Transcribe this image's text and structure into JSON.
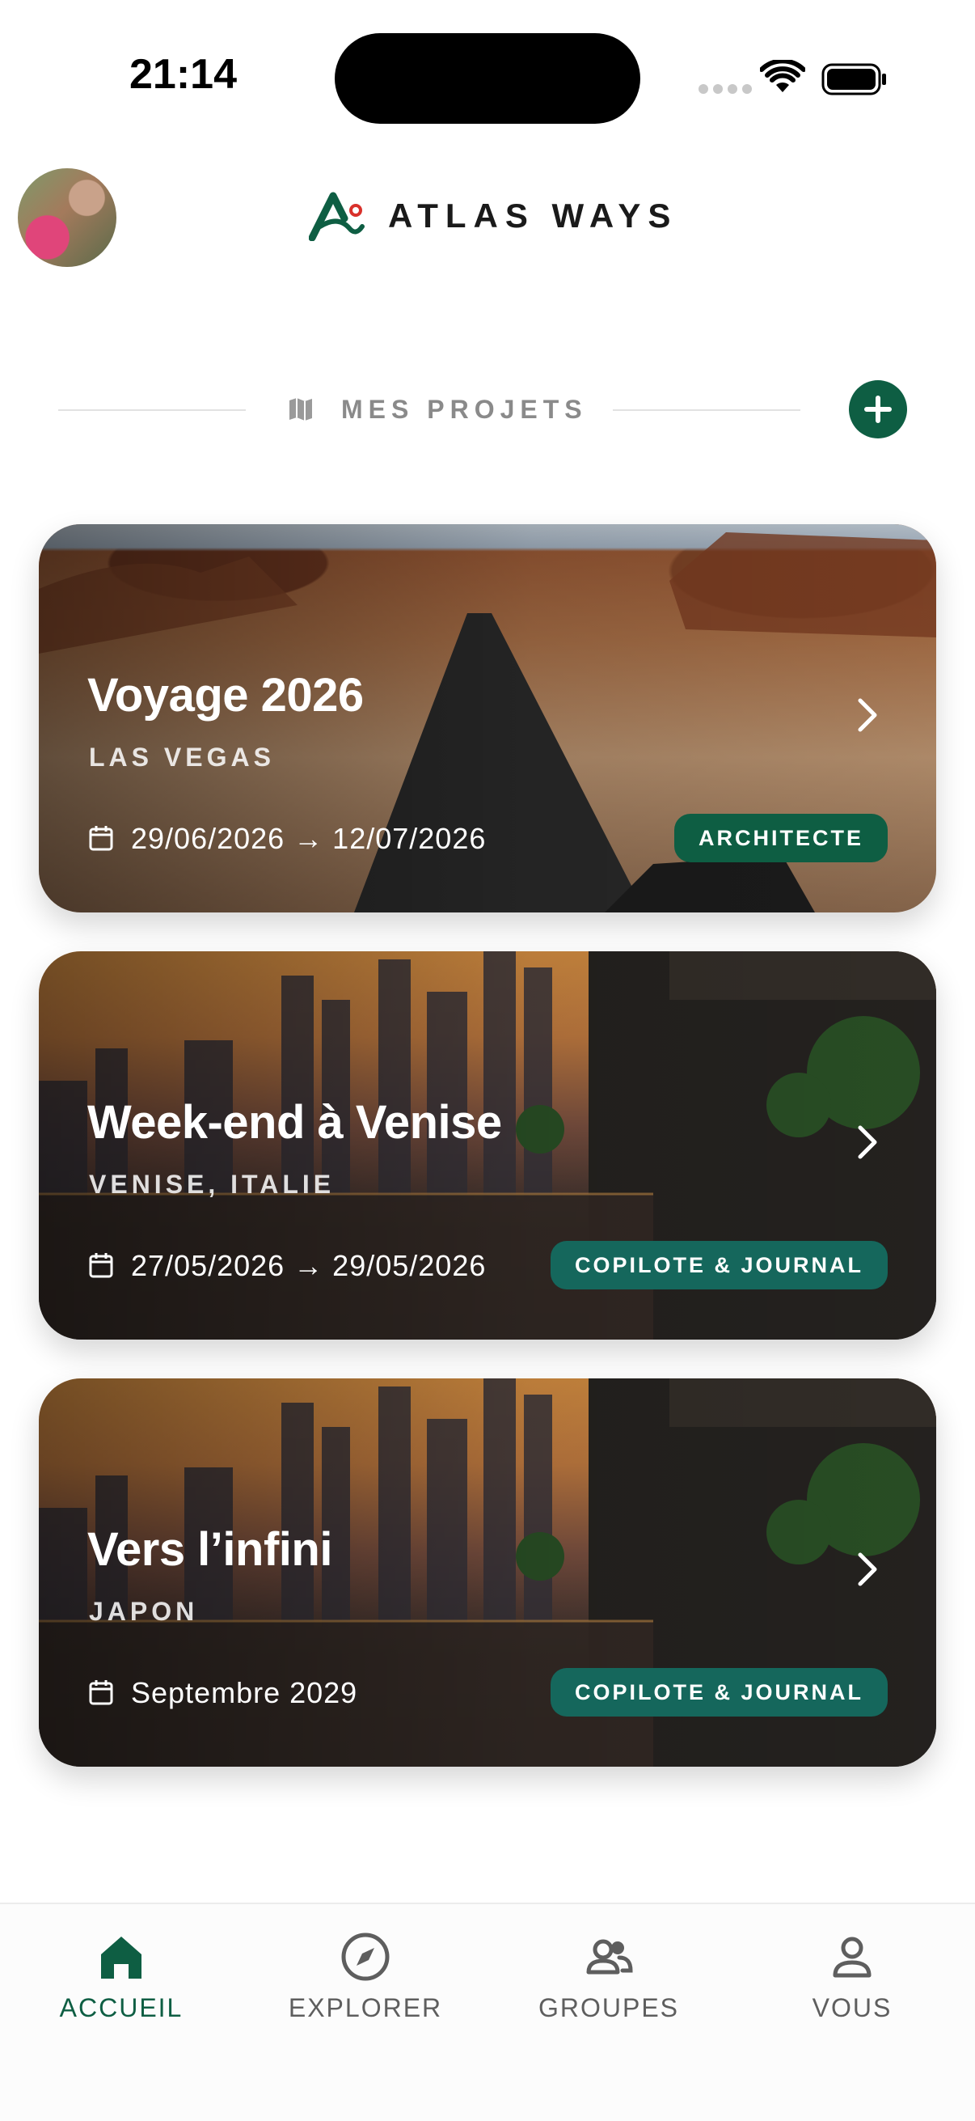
{
  "status_bar": {
    "time": "21:14"
  },
  "header": {
    "app_name": "ATLAS WAYS",
    "avatar_icon": "user-avatar",
    "logo_icon": "atlas-ways-logo"
  },
  "section": {
    "title": "MES PROJETS",
    "icon": "map-icon",
    "add_icon": "plus-icon"
  },
  "projects": [
    {
      "title": "Voyage 2026",
      "location": "LAS VEGAS",
      "dates": "29/06/2026 → 12/07/2026",
      "badge": "ARCHITECTE"
    },
    {
      "title": "Week-end à Venise",
      "location": "VENISE, ITALIE",
      "dates": "27/05/2026 → 29/05/2026",
      "badge": "COPILOTE & JOURNAL"
    },
    {
      "title": "Vers l’infini",
      "location": "JAPON",
      "dates": "Septembre 2029",
      "badge": "COPILOTE & JOURNAL"
    }
  ],
  "tabs": [
    {
      "label": "ACCUEIL",
      "icon": "home-icon",
      "active": true
    },
    {
      "label": "EXPLORER",
      "icon": "compass-icon",
      "active": false
    },
    {
      "label": "GROUPES",
      "icon": "group-icon",
      "active": false
    },
    {
      "label": "VOUS",
      "icon": "person-icon",
      "active": false
    }
  ],
  "colors": {
    "brand_green": "#0e5e43",
    "badge_teal": "#15675c",
    "inactive_gray": "#5e5e5e"
  }
}
